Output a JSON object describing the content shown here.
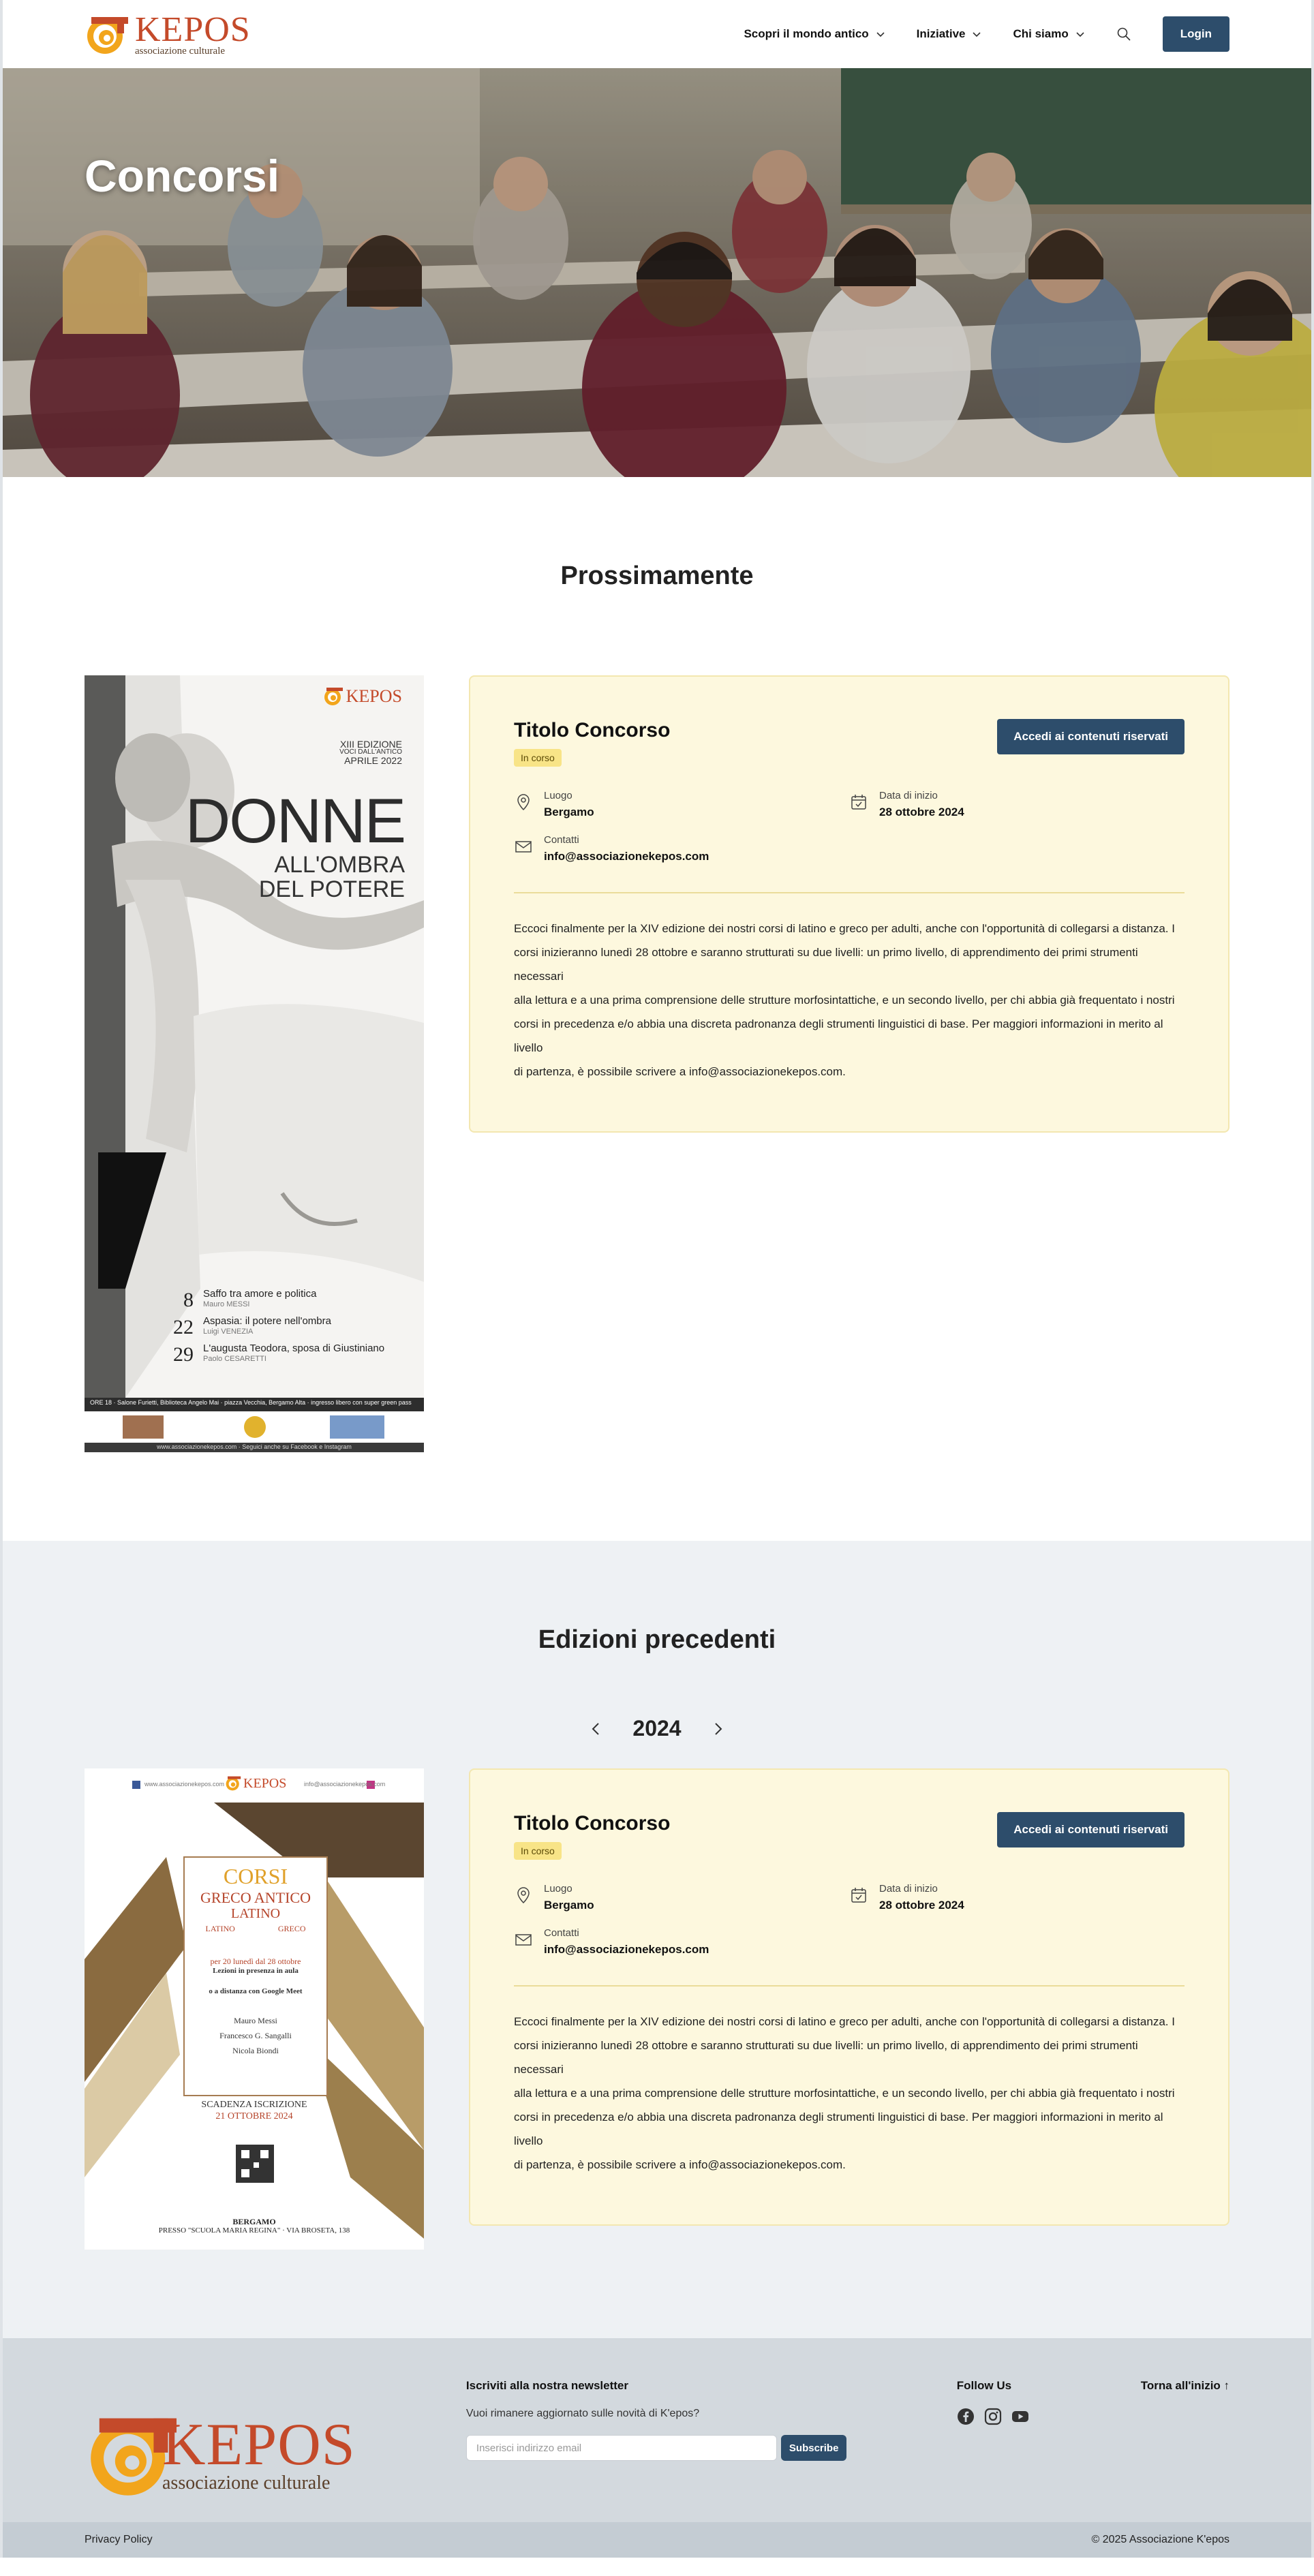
{
  "header": {
    "logo_name": "KEPOS",
    "logo_sub": "associazione culturale",
    "nav": [
      "Scopri il mondo antico",
      "Iniziative",
      "Chi siamo"
    ],
    "login": "Login"
  },
  "hero": {
    "title": "Concorsi"
  },
  "upcoming": {
    "title": "Prossimamente",
    "poster": {
      "brand": "KEPOS",
      "edition": "XIII EDIZIONE",
      "subtitle": "VOCI DALL'ANTICO",
      "month": "APRILE 2022",
      "title1": "DONNE",
      "title2": "ALL'OMBRA",
      "title3": "DEL POTERE",
      "events": [
        {
          "day": "8",
          "title": "Saffo tra amore e politica",
          "speaker": "Mauro MESSI"
        },
        {
          "day": "22",
          "title": "Aspasia: il potere nell'ombra",
          "speaker": "Luigi VENEZIA"
        },
        {
          "day": "29",
          "title": "L'augusta Teodora, sposa di Giustiniano",
          "speaker": "Paolo CESARETTI"
        }
      ],
      "info": "ORE 18 · Salone Furietti, Biblioteca Angelo Mai · piazza Vecchia, Bergamo Alta · ingresso libero con super green pass",
      "footer": "www.associazionekepos.com · Seguici anche su Facebook e Instagram"
    },
    "card": {
      "title": "Titolo Concorso",
      "badge": "In corso",
      "button": "Accedi ai contenuti riservati",
      "place_label": "Luogo",
      "place": "Bergamo",
      "date_label": "Data di inizio",
      "date": "28 ottobre 2024",
      "contact_label": "Contatti",
      "contact": "info@associazionekepos.com",
      "lines": [
        "Eccoci finalmente per la XIV edizione dei nostri corsi di latino e greco per adulti, anche con l'opportunità di collegarsi a distanza. I",
        "corsi inizieranno lunedì 28 ottobre e saranno strutturati su due livelli: un primo livello, di apprendimento dei primi strumenti necessari",
        "alla lettura e a una prima comprensione delle strutture morfosintattiche, e un secondo livello, per chi abbia già frequentato i nostri",
        "corsi in precedenza e/o abbia una discreta padronanza degli strumenti linguistici di base. Per maggiori informazioni in merito al livello",
        "di partenza, è possibile scrivere a info@associazionekepos.com."
      ]
    }
  },
  "previous": {
    "title": "Edizioni precedenti",
    "year": "2024",
    "poster": {
      "brand": "KEPOS",
      "site": "www.associazionekepos.com",
      "mail": "info@associazionekepos.com",
      "corsi": "CORSI",
      "greco_antico": "GRECO ANTICO",
      "latino": "LATINO",
      "latino_lbl": "LATINO",
      "greco_lbl": "GRECO",
      "dates": "per 20 lunedì dal 28 ottobre",
      "presenza": "Lezioni in presenza in aula",
      "distanza": "o a distanza con Google Meet",
      "teacher1": "Mauro Messi",
      "teacher2": "Francesco G. Sangalli",
      "teacher3": "Nicola Biondi",
      "deadline_lbl": "SCADENZA ISCRIZIONE",
      "deadline": "21 OTTOBRE 2024",
      "city": "BERGAMO",
      "venue": "PRESSO \"SCUOLA MARIA REGINA\" · VIA BROSETA, 138"
    },
    "card": {
      "title": "Titolo Concorso",
      "badge": "In corso",
      "button": "Accedi ai contenuti riservati",
      "place_label": "Luogo",
      "place": "Bergamo",
      "date_label": "Data di inizio",
      "date": "28 ottobre 2024",
      "contact_label": "Contatti",
      "contact": "info@associazionekepos.com",
      "lines": [
        "Eccoci finalmente per la XIV edizione dei nostri corsi di latino e greco per adulti, anche con l'opportunità di collegarsi a distanza. I",
        "corsi inizieranno lunedì 28 ottobre e saranno strutturati su due livelli: un primo livello, di apprendimento dei primi strumenti necessari",
        "alla lettura e a una prima comprensione delle strutture morfosintattiche, e un secondo livello, per chi abbia già frequentato i nostri",
        "corsi in precedenza e/o abbia una discreta padronanza degli strumenti linguistici di base. Per maggiori informazioni in merito al livello",
        "di partenza, è possibile scrivere a info@associazionekepos.com."
      ]
    }
  },
  "footer": {
    "logo_name": "KEPOS",
    "logo_sub": "associazione culturale",
    "newsletter_title": "Iscriviti alla nostra newsletter",
    "newsletter_text": "Vuoi rimanere aggiornato sulle novità di K'epos?",
    "email_placeholder": "Inserisci indirizzo email",
    "subscribe": "Subscribe",
    "follow": "Follow Us",
    "back_top": "Torna all'inizio ↑",
    "privacy": "Privacy Policy",
    "copyright": "© 2025 Associazione K'epos"
  },
  "colors": {
    "primary": "#2d4d6b",
    "card_bg": "#fdf8de",
    "badge": "#f8e487",
    "logo": "#c44a2a",
    "logo_swirl": "#f2a51c"
  }
}
